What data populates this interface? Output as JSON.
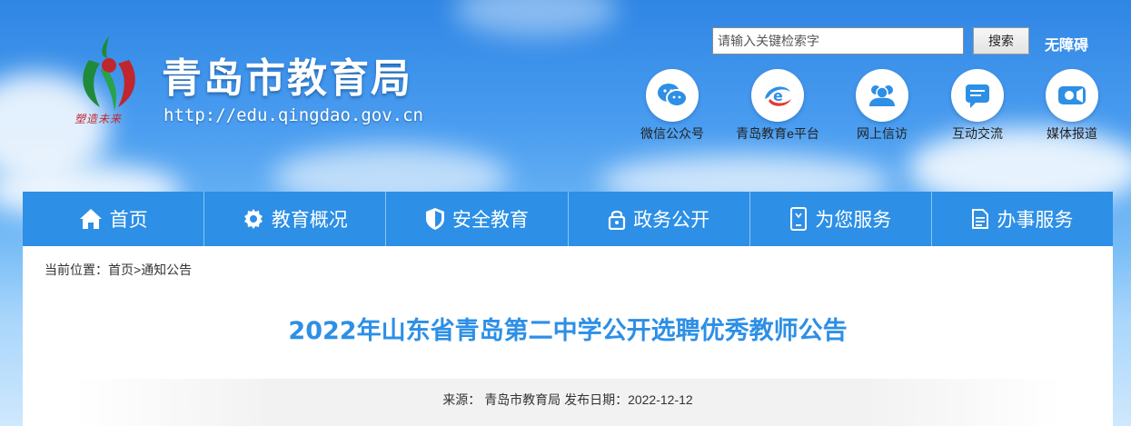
{
  "header": {
    "site_title": "青岛市教育局",
    "site_url": "http://edu.qingdao.gov.cn",
    "logo_slogan": "塑造未来"
  },
  "search": {
    "placeholder": "请输入关键检索字",
    "button_label": "搜索"
  },
  "accessibility_label": "无障碍",
  "quick_links": [
    {
      "label": "微信公众号",
      "icon": "wechat-icon"
    },
    {
      "label": "青岛教育e平台",
      "icon": "e-platform-icon"
    },
    {
      "label": "网上信访",
      "icon": "people-icon"
    },
    {
      "label": "互动交流",
      "icon": "chat-icon"
    },
    {
      "label": "媒体报道",
      "icon": "video-icon"
    }
  ],
  "nav": [
    {
      "label": "首页",
      "icon": "home-icon"
    },
    {
      "label": "教育概况",
      "icon": "gear-icon"
    },
    {
      "label": "安全教育",
      "icon": "shield-icon"
    },
    {
      "label": "政务公开",
      "icon": "lock-icon"
    },
    {
      "label": "为您服务",
      "icon": "phone-icon"
    },
    {
      "label": "办事服务",
      "icon": "document-icon"
    }
  ],
  "breadcrumb": {
    "prefix": "当前位置：",
    "home": "首页",
    "separator": ">",
    "current": "通知公告"
  },
  "article": {
    "title": "2022年山东省青岛第二中学公开选聘优秀教师公告",
    "source_label": "来源：",
    "source": "青岛市教育局",
    "date_label": "发布日期：",
    "date": "2022-12-12"
  },
  "colors": {
    "brand_blue": "#2d8fe6",
    "nav_divider": "#8cc4f3",
    "logo_red": "#c0262d",
    "logo_green": "#1f8a3a"
  }
}
